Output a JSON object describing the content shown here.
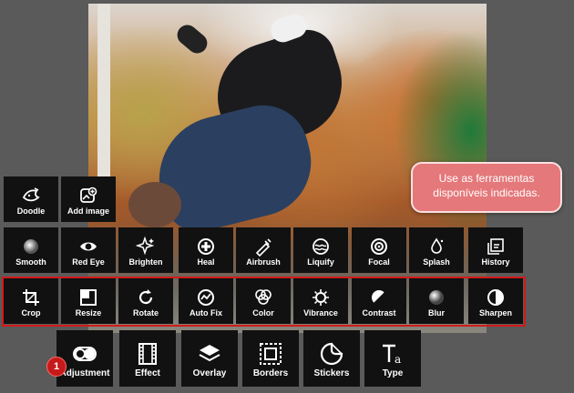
{
  "tools_row_top": [
    {
      "label": "Doodle",
      "icon": "doodle-icon"
    },
    {
      "label": "Add image",
      "icon": "add-image-icon"
    }
  ],
  "tools_row_middle": [
    {
      "label": "Smooth",
      "icon": "smooth-icon"
    },
    {
      "label": "Red Eye",
      "icon": "eye-icon"
    },
    {
      "label": "Brighten",
      "icon": "sparkle-icon"
    },
    {
      "label": "Heal",
      "icon": "heal-icon"
    },
    {
      "label": "Airbrush",
      "icon": "airbrush-icon"
    },
    {
      "label": "Liquify",
      "icon": "liquify-icon"
    },
    {
      "label": "Focal",
      "icon": "target-icon"
    },
    {
      "label": "Splash",
      "icon": "splash-icon"
    },
    {
      "label": "History",
      "icon": "history-icon"
    }
  ],
  "tools_row_main": [
    {
      "label": "Crop",
      "icon": "crop-icon"
    },
    {
      "label": "Resize",
      "icon": "resize-icon"
    },
    {
      "label": "Rotate",
      "icon": "rotate-icon"
    },
    {
      "label": "Auto Fix",
      "icon": "auto-fix-icon"
    },
    {
      "label": "Color",
      "icon": "color-icon"
    },
    {
      "label": "Vibrance",
      "icon": "vibrance-icon"
    },
    {
      "label": "Contrast",
      "icon": "contrast-icon"
    },
    {
      "label": "Blur",
      "icon": "blur-icon"
    },
    {
      "label": "Sharpen",
      "icon": "sharpen-icon"
    }
  ],
  "tools_row_bottom": [
    {
      "label": "Adjustment",
      "icon": "adjustment-toggle-icon"
    },
    {
      "label": "Effect",
      "icon": "film-icon"
    },
    {
      "label": "Overlay",
      "icon": "layers-icon"
    },
    {
      "label": "Borders",
      "icon": "border-frame-icon"
    },
    {
      "label": "Stickers",
      "icon": "sticker-icon"
    },
    {
      "label": "Type",
      "icon": "type-icon"
    }
  ],
  "callout": {
    "line1": "Use as ferramentas",
    "line2": "disponíveis indicadas."
  },
  "badge": "1",
  "colors": {
    "highlight": "#d11a1a",
    "callout_bg": "#e4787a",
    "badge": "#c61a1a",
    "tile": "#111111"
  }
}
